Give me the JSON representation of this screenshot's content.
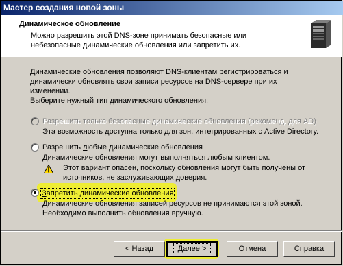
{
  "window": {
    "title": "Мастер создания новой зоны"
  },
  "header": {
    "title": "Динамическое обновление",
    "subtitle": "Можно разрешить этой DNS-зоне принимать безопасные или небезопасные динамические обновления или запретить их.",
    "icon": "server-icon"
  },
  "body": {
    "intro": "Динамические обновления позволяют DNS-клиентам регистрироваться и динамически обновлять свои записи ресурсов на DNS-сервере при их изменении.",
    "prompt": "Выберите нужный тип динамического обновления:",
    "options": [
      {
        "label": "Разрешить только безопасные динамические обновления (рекоменд. для AD)",
        "desc": "Эта возможность доступна только для зон, интегрированных с Active Directory.",
        "state": "disabled"
      },
      {
        "label_pre": "Разрешить ",
        "label_ul": "л",
        "label_post": "юбые динамические обновления",
        "desc": "Динамические обновления могут выполняться любым клиентом.",
        "warning": "Этот вариант опасен, поскольку обновления могут быть получены от источников, не заслуживающих доверия.",
        "state": "unselected"
      },
      {
        "label_ul": "З",
        "label_post": "апретить динамические обновления",
        "desc": "Динамические обновления записей ресурсов не принимаются этой зоной. Необходимо выполнить обновления вручную.",
        "state": "selected"
      }
    ]
  },
  "buttons": {
    "back_pre": "< ",
    "back_ul": "Н",
    "back_post": "азад",
    "next_ul": "Д",
    "next_post": "алее >",
    "cancel": "Отмена",
    "help": "Справка"
  },
  "colors": {
    "titlebar_start": "#0a246a",
    "titlebar_end": "#a6caf0",
    "highlight": "#f2f21a",
    "face": "#d4d0c8"
  }
}
